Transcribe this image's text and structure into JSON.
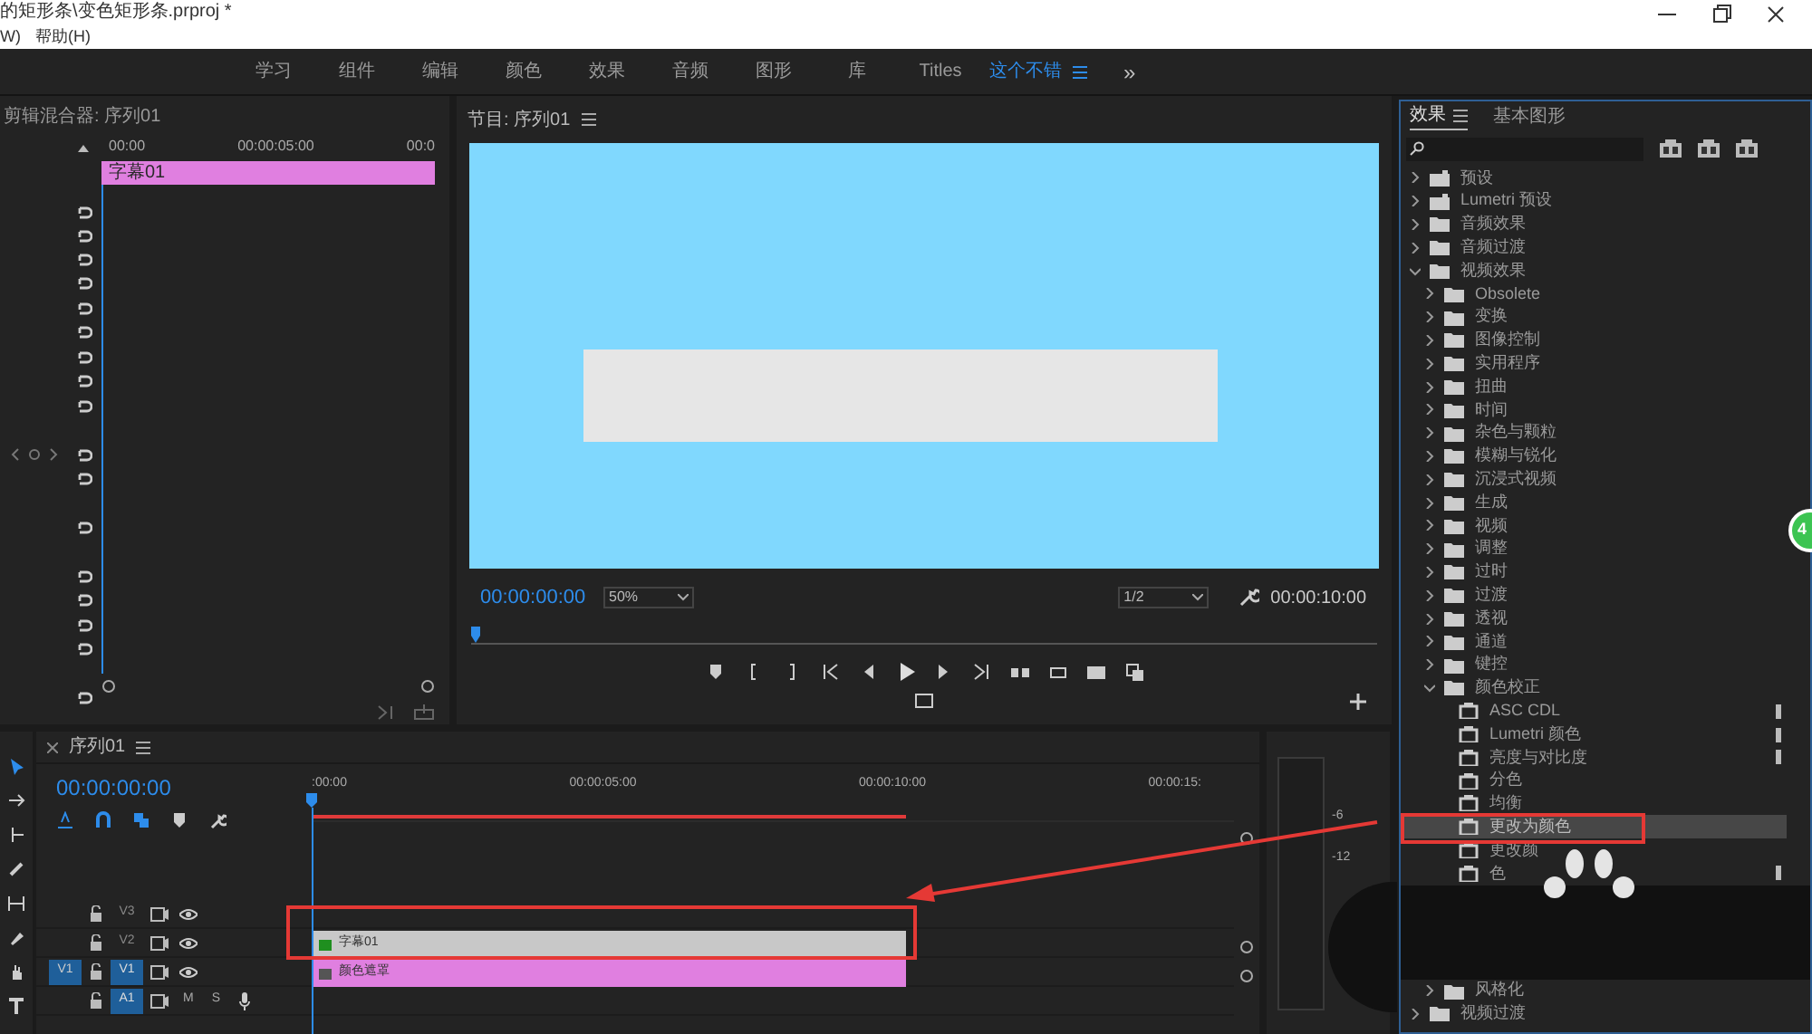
{
  "window": {
    "title": "的矩形条\\变色矩形条.prproj *"
  },
  "menu": [
    "W)",
    "帮助(H)"
  ],
  "workspaces": [
    {
      "label": "学习",
      "selected": false
    },
    {
      "label": "组件",
      "selected": false
    },
    {
      "label": "编辑",
      "selected": false
    },
    {
      "label": "颜色",
      "selected": false
    },
    {
      "label": "效果",
      "selected": false
    },
    {
      "label": "音频",
      "selected": false
    },
    {
      "label": "图形",
      "selected": false
    },
    {
      "label": "库",
      "selected": false
    },
    {
      "label": "Titles",
      "selected": false
    },
    {
      "label": "这个不错",
      "selected": true
    }
  ],
  "workspace_overflow": "»",
  "clip_panel": {
    "title": "剪辑混合器: 序列01",
    "ruler": [
      "00:00",
      "00:00:05:00",
      "00:0"
    ],
    "clip": "字幕01"
  },
  "program": {
    "title": "节目: 序列01",
    "timecode": "00:00:00:00",
    "zoom": "50%",
    "resolution": "1/2",
    "duration": "00:00:10:00"
  },
  "effects_panel": {
    "tabs": [
      {
        "label": "效果",
        "selected": true
      },
      {
        "label": "基本图形",
        "selected": false
      }
    ],
    "tree": [
      {
        "label": "预设",
        "kind": "preset_bin",
        "expanded": false
      },
      {
        "label": "Lumetri 预设",
        "kind": "preset_bin",
        "expanded": false
      },
      {
        "label": "音频效果",
        "kind": "folder",
        "expanded": false
      },
      {
        "label": "音频过渡",
        "kind": "folder",
        "expanded": false
      },
      {
        "label": "视频效果",
        "kind": "folder",
        "expanded": true,
        "children": [
          {
            "label": "Obsolete",
            "kind": "folder",
            "expanded": false
          },
          {
            "label": "变换",
            "kind": "folder",
            "expanded": false
          },
          {
            "label": "图像控制",
            "kind": "folder",
            "expanded": false
          },
          {
            "label": "实用程序",
            "kind": "folder",
            "expanded": false
          },
          {
            "label": "扭曲",
            "kind": "folder",
            "expanded": false
          },
          {
            "label": "时间",
            "kind": "folder",
            "expanded": false
          },
          {
            "label": "杂色与颗粒",
            "kind": "folder",
            "expanded": false
          },
          {
            "label": "模糊与锐化",
            "kind": "folder",
            "expanded": false
          },
          {
            "label": "沉浸式视频",
            "kind": "folder",
            "expanded": false
          },
          {
            "label": "生成",
            "kind": "folder",
            "expanded": false
          },
          {
            "label": "视频",
            "kind": "folder",
            "expanded": false
          },
          {
            "label": "调整",
            "kind": "folder",
            "expanded": false
          },
          {
            "label": "过时",
            "kind": "folder",
            "expanded": false
          },
          {
            "label": "过渡",
            "kind": "folder",
            "expanded": false
          },
          {
            "label": "透视",
            "kind": "folder",
            "expanded": false
          },
          {
            "label": "通道",
            "kind": "folder",
            "expanded": false
          },
          {
            "label": "键控",
            "kind": "folder",
            "expanded": false
          },
          {
            "label": "颜色校正",
            "kind": "folder",
            "expanded": true,
            "children": [
              {
                "label": "ASC CDL",
                "kind": "effect",
                "selected": false,
                "accelerated": true
              },
              {
                "label": "Lumetri 颜色",
                "kind": "effect",
                "selected": false,
                "accelerated": true
              },
              {
                "label": "亮度与对比度",
                "kind": "effect",
                "selected": false,
                "accelerated": true
              },
              {
                "label": "分色",
                "kind": "effect",
                "selected": false,
                "accelerated": false
              },
              {
                "label": "均衡",
                "kind": "effect",
                "selected": false,
                "accelerated": false
              },
              {
                "label": "更改为颜色",
                "kind": "effect",
                "selected": true,
                "accelerated": false
              },
              {
                "label": "更改颜",
                "kind": "effect",
                "selected": false,
                "accelerated": false
              },
              {
                "label": "色",
                "kind": "effect",
                "selected": false,
                "accelerated": true
              }
            ]
          },
          {
            "label": "风格化",
            "kind": "folder",
            "expanded": false
          }
        ]
      },
      {
        "label": "视频过渡",
        "kind": "folder",
        "expanded": false
      }
    ]
  },
  "timeline": {
    "title": "序列01",
    "timecode": "00:00:00:00",
    "ruler": [
      ":00:00",
      "00:00:05:00",
      "00:00:10:00",
      "00:00:15:"
    ],
    "tracks": [
      {
        "label": "V3",
        "kind": "video",
        "targeted": false
      },
      {
        "label": "V2",
        "kind": "video",
        "targeted": false,
        "clip": {
          "label": "字幕01",
          "kind": "title"
        }
      },
      {
        "label": "V1",
        "kind": "video",
        "targeted": true,
        "source": "V1",
        "clip": {
          "label": "颜色遮罩",
          "kind": "matte"
        }
      },
      {
        "label": "A1",
        "kind": "audio",
        "targeted": true,
        "mute": "M",
        "solo": "S"
      }
    ]
  },
  "meter": {
    "labels": [
      "-6",
      "-12"
    ]
  },
  "badge": "4"
}
